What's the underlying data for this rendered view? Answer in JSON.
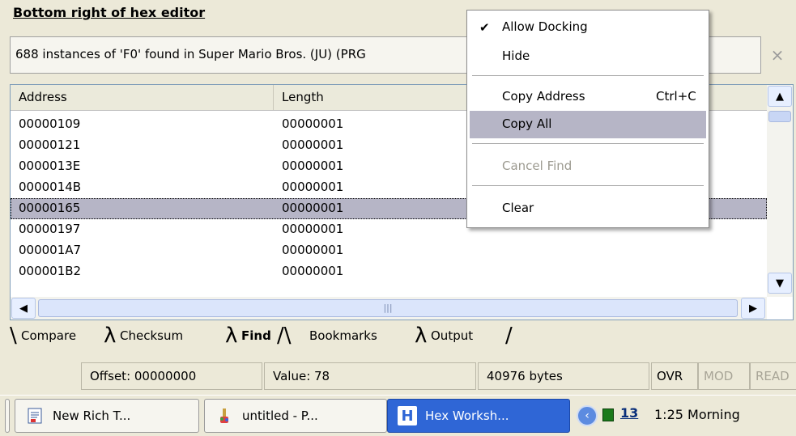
{
  "panel_title": "Bottom right of hex editor",
  "status_message": "688 instances of 'F0' found in Super Mario Bros. (JU) (PRG",
  "close_glyph": "×",
  "columns": [
    "Address",
    "Length"
  ],
  "rows": [
    {
      "address": "00000109",
      "length": "00000001"
    },
    {
      "address": "00000121",
      "length": "00000001"
    },
    {
      "address": "0000013E",
      "length": "00000001"
    },
    {
      "address": "0000014B",
      "length": "00000001"
    },
    {
      "address": "00000165",
      "length": "00000001",
      "selected": true
    },
    {
      "address": "00000197",
      "length": "00000001"
    },
    {
      "address": "000001A7",
      "length": "00000001"
    },
    {
      "address": "000001B2",
      "length": "00000001"
    }
  ],
  "tabs": [
    "Compare",
    "Checksum",
    "Find",
    "Bookmarks",
    "Output"
  ],
  "active_tab": "Find",
  "statusbar": {
    "offset": "Offset: 00000000",
    "value": "Value: 78",
    "size": "40976 bytes",
    "ovr": "OVR",
    "mod": "MOD",
    "read": "READ"
  },
  "taskbar": {
    "tasks": [
      "New Rich T...",
      "untitled - P...",
      "Hex Worksh..."
    ],
    "tray_date": "13",
    "clock": "1:25 Morning"
  },
  "context_menu": {
    "items": [
      {
        "label": "Allow Docking",
        "checked": true
      },
      {
        "label": "Hide"
      },
      {
        "label": "Copy Address",
        "shortcut": "Ctrl+C"
      },
      {
        "label": "Copy All",
        "highlighted": true
      },
      {
        "label": "Cancel Find",
        "disabled": true
      },
      {
        "label": "Clear"
      }
    ]
  },
  "colors": {
    "selection": "#b6b5c6",
    "active_task": "#2f66d6",
    "window_bg": "#ece9d8"
  }
}
